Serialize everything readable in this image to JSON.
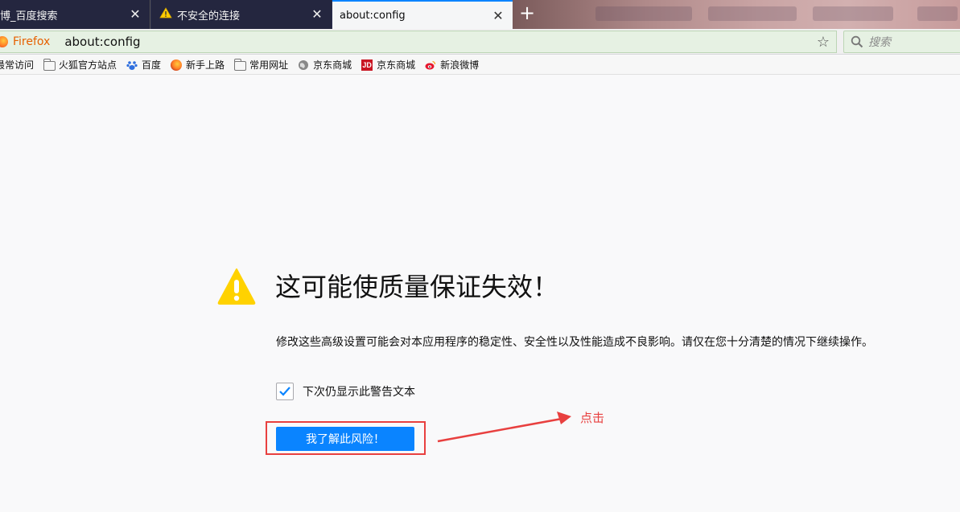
{
  "tabs": [
    {
      "label": "微博_百度搜索",
      "close": "✕"
    },
    {
      "label": "不安全的连接",
      "close": "✕"
    },
    {
      "label": "about:config",
      "close": "✕",
      "active": true
    }
  ],
  "new_tab_glyph": "+",
  "urlbar": {
    "identity": "Firefox",
    "url": "about:config",
    "star_icon": "☆"
  },
  "search": {
    "placeholder": "搜索"
  },
  "bookmarks": [
    {
      "label": "最常访问",
      "icon": "star-icon"
    },
    {
      "label": "火狐官方站点",
      "icon": "folder-icon"
    },
    {
      "label": "百度",
      "icon": "baidu-paw-icon"
    },
    {
      "label": "新手上路",
      "icon": "firefox-icon"
    },
    {
      "label": "常用网址",
      "icon": "folder-icon"
    },
    {
      "label": "京东商城",
      "icon": "globe-icon"
    },
    {
      "label": "京东商城",
      "icon": "jd-icon"
    },
    {
      "label": "新浪微博",
      "icon": "weibo-icon"
    }
  ],
  "warning": {
    "title": "这可能使质量保证失效！",
    "description": "修改这些高级设置可能会对本应用程序的稳定性、安全性以及性能造成不良影响。请仅在您十分清楚的情况下继续操作。",
    "checkbox_label": "下次仍显示此警告文本",
    "checkbox_checked": true,
    "accept_button": "我了解此风险！"
  },
  "annotation": {
    "text": "点击",
    "color": "#e8403f"
  },
  "colors": {
    "accent": "#0a84ff",
    "warning": "#ffcc00",
    "tabstrip": "#2b2d4d"
  }
}
